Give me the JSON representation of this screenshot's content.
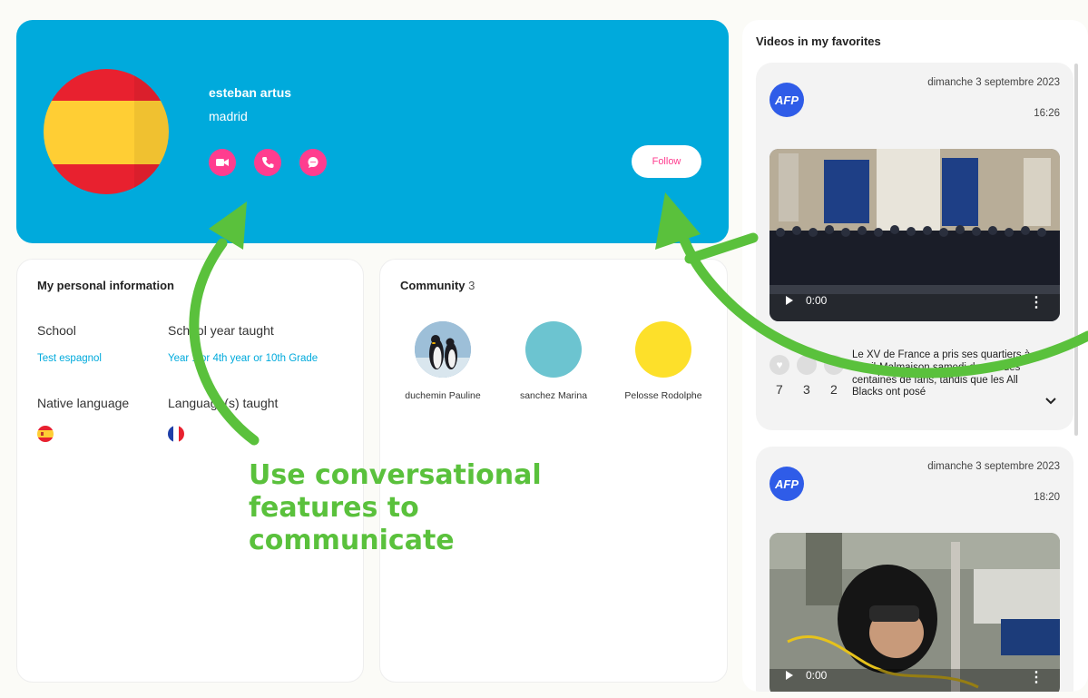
{
  "profile": {
    "name": "esteban artus",
    "city": "madrid",
    "follow_label": "Follow",
    "colors": {
      "card_bg": "#00aadc",
      "accent": "#ff3d8f"
    },
    "contact_icons": [
      "video-camera-icon",
      "phone-icon",
      "chat-bubble-icon"
    ]
  },
  "personal_info": {
    "title": "My personal information",
    "school_label": "School",
    "school_value": "Test espagnol",
    "year_label": "School year taught",
    "year_value": "Year 1 or 4th year or 10th Grade",
    "native_label": "Native language",
    "taught_label": "Language(s) taught",
    "native_flag": "spain-flag-icon",
    "taught_flag": "france-flag-icon"
  },
  "community": {
    "title": "Community",
    "count": "3",
    "members": [
      {
        "name": "duchemin Pauline",
        "avatar": "penguin-photo"
      },
      {
        "name": "sanchez Marina",
        "avatar": "teal-circle",
        "color": "#6cc4d0"
      },
      {
        "name": "Pelosse Rodolphe",
        "avatar": "yellow-circle",
        "color": "#fde02a"
      }
    ]
  },
  "favorites": {
    "title": "Videos in my favorites",
    "videos": [
      {
        "source": "AFP",
        "date": "dimanche 3 septembre 2023",
        "time": "16:26",
        "player_time": "0:00",
        "reactions": [
          "7",
          "3",
          "2"
        ],
        "description": "Le XV de France a pris ses quartiers à Rueil-Malmaison samedi devant des centaines de fans, tandis que les All Blacks ont posé"
      },
      {
        "source": "AFP",
        "date": "dimanche 3 septembre 2023",
        "time": "18:20",
        "player_time": "0:00"
      }
    ]
  },
  "annotation": {
    "text": "Use conversational features to communicate",
    "color": "#5ac13c"
  }
}
